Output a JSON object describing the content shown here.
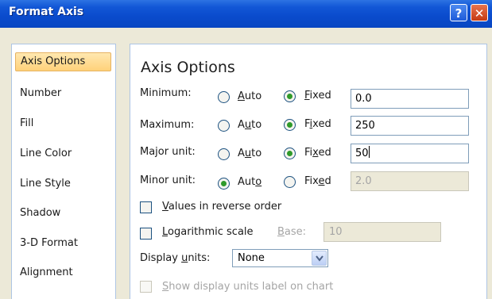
{
  "window": {
    "title": "Format Axis",
    "help_glyph": "?",
    "close_glyph": "✕"
  },
  "nav": {
    "items": [
      {
        "label": "Axis Options",
        "selected": true
      },
      {
        "label": "Number"
      },
      {
        "label": "Fill"
      },
      {
        "label": "Line Color"
      },
      {
        "label": "Line Style"
      },
      {
        "label": "Shadow"
      },
      {
        "label": "3-D Format"
      },
      {
        "label": "Alignment"
      }
    ]
  },
  "panel": {
    "heading": "Axis Options",
    "auto_label": "Auto",
    "fixed_label": "Fixed",
    "rows": [
      {
        "label": "Minimum:",
        "mode": "Fixed",
        "value": "0.0"
      },
      {
        "label": "Maximum:",
        "mode": "Fixed",
        "value": "250"
      },
      {
        "label": "Major unit:",
        "mode": "Fixed",
        "value": "50"
      },
      {
        "label": "Minor unit:",
        "mode": "Auto",
        "value": "2.0"
      }
    ],
    "reverse_order": {
      "label": "Values in reverse order",
      "checked": false
    },
    "log_scale": {
      "label": "Logarithmic scale",
      "checked": false,
      "base_label": "Base:",
      "base_value": "10"
    },
    "display_units": {
      "label": "Display units:",
      "value": "None"
    },
    "show_units_label": {
      "label": "Show display units label on chart",
      "checked": false,
      "enabled": false
    }
  },
  "colors": {
    "titlebar": "#0a4bcc",
    "selected_nav": "#ffd27a",
    "radio_dot": "#2f9a2a"
  }
}
